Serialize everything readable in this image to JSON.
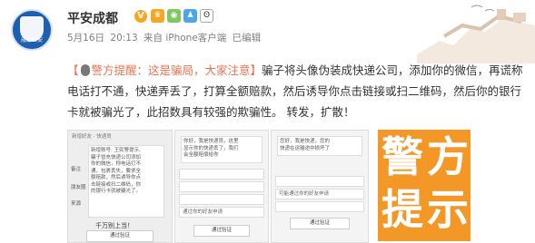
{
  "account": {
    "name": "平安成都",
    "avatar_text": "成都公安"
  },
  "meta": {
    "date": "5月16日",
    "time": "20:13",
    "source": "来自 iPhone客户端",
    "edited": "已编辑"
  },
  "post": {
    "tag_open": "【",
    "tag_text": "警方提醒：这是骗局，大家注意",
    "tag_close": "】",
    "body": "骗子将头像伪装成快递公司，添加你的微信，再谎称电话打不通，快递弄丢了，打算全额赔款，然后诱导你点击链接或扫二维码，然后你的银行卡就被骗光了，此招数具有较强的欺骗性。 转发，扩散！"
  },
  "shot1": {
    "header": "新增好友 · 快递员",
    "lines": [
      "新增账号: 王民警提示,",
      "骗子冒充快递公司添加",
      "你的微信，称电话打不",
      "通，包裹丢失，要求全",
      "额赔款，然后诱导你点",
      "击链接或扫二维码，你",
      "的银行卡就被骗光了。"
    ],
    "labels": [
      "备注",
      "朋友圈",
      "来源"
    ],
    "footer": "千万别上当！",
    "button": "通过验证"
  },
  "shot2": {
    "lines": [
      "你好，我是快递员，这里",
      "显示你的快递丢了，我们",
      "会全额赔偿给你"
    ],
    "rows": [
      "",
      "",
      "",
      "",
      "通过你的好友申请"
    ],
    "button": "通过验证"
  },
  "shot3": {
    "lines": [
      "您好，我是快递，您的",
      "快递在运输途中损坏了"
    ],
    "rows": [
      "",
      "可能通过你的好友申请",
      ""
    ],
    "button": "通过验证"
  },
  "poster": {
    "line1a": "警",
    "line1b": "方",
    "line2a": "提",
    "line2b": "示"
  },
  "colors": {
    "accent": "#eb7350",
    "poster": "#f39726",
    "avatar": "#1f5fb0"
  }
}
